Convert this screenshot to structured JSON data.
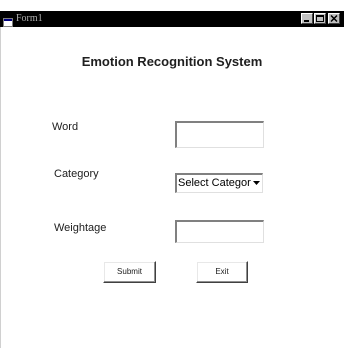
{
  "window": {
    "title": "Form1"
  },
  "form": {
    "heading": "Emotion Recognition System",
    "word_label": "Word",
    "word_value": "",
    "category_label": "Category",
    "category_selected": "Select Category",
    "weightage_label": "Weightage",
    "weightage_value": "",
    "submit_label": "Submit",
    "exit_label": "Exit"
  },
  "icons": {
    "app": "app-window-icon",
    "minimize": "minimize-icon",
    "maximize": "maximize-icon",
    "close": "close-icon",
    "dropdown": "chevron-down-icon"
  },
  "colors": {
    "titlebar": "#000000",
    "client": "#ffffff",
    "button_face": "#c0c0c0"
  }
}
